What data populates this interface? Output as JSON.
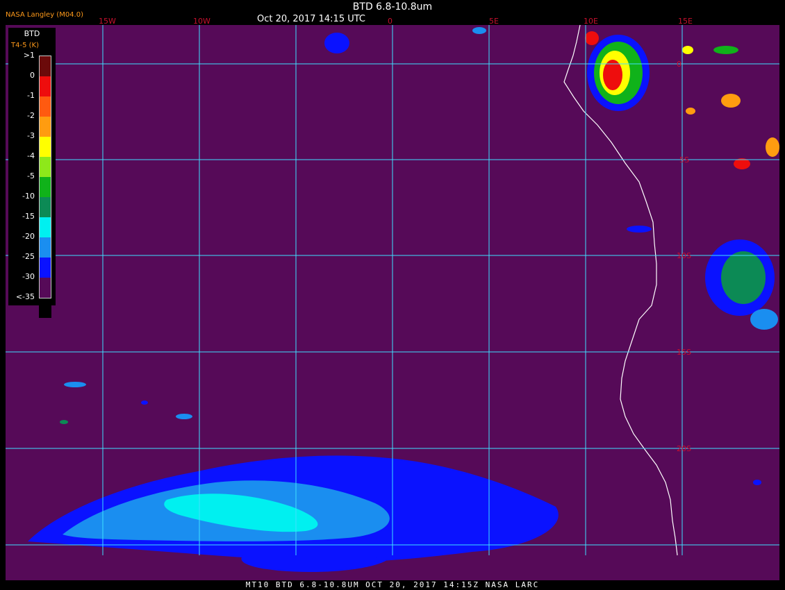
{
  "header": {
    "title": "BTD 6.8-10.8um",
    "datetime": "Oct 20, 2017 14:15 UTC",
    "org": "NASA Langley (M04.0)"
  },
  "footer": {
    "text": "MT10  BTD 6.8-10.8UM   OCT 20, 2017 14:15Z   NASA LARC"
  },
  "legend": {
    "title": "BTD",
    "subtitle": "T4-5 (K)",
    "bins": [
      {
        "label": ">1",
        "color": "#6b0a0a"
      },
      {
        "label": "0",
        "color": "#ee0d0d"
      },
      {
        "label": "-1",
        "color": "#ff5a10"
      },
      {
        "label": "-2",
        "color": "#ff9c10"
      },
      {
        "label": "-3",
        "color": "#ffff00"
      },
      {
        "label": "-4",
        "color": "#8ee81a"
      },
      {
        "label": "-5",
        "color": "#10b21a"
      },
      {
        "label": "-10",
        "color": "#0c8a55"
      },
      {
        "label": "-15",
        "color": "#00f0f0"
      },
      {
        "label": "-20",
        "color": "#1a8ef0"
      },
      {
        "label": "-25",
        "color": "#0a12ff"
      },
      {
        "label": "-30",
        "color": "#560a58"
      },
      {
        "label": "<-35",
        "color": "#000000"
      }
    ]
  },
  "grid": {
    "lon_labels": [
      "15W",
      "10W",
      "0",
      "5E",
      "10E",
      "15E"
    ],
    "lat_labels": [
      "0",
      "5S",
      "10S",
      "15S",
      "20S"
    ],
    "label_color": "#c8102e",
    "line_color": "#3fe0ff"
  },
  "colors": {
    "background": "#560a58",
    "coast": "#ffffff"
  }
}
